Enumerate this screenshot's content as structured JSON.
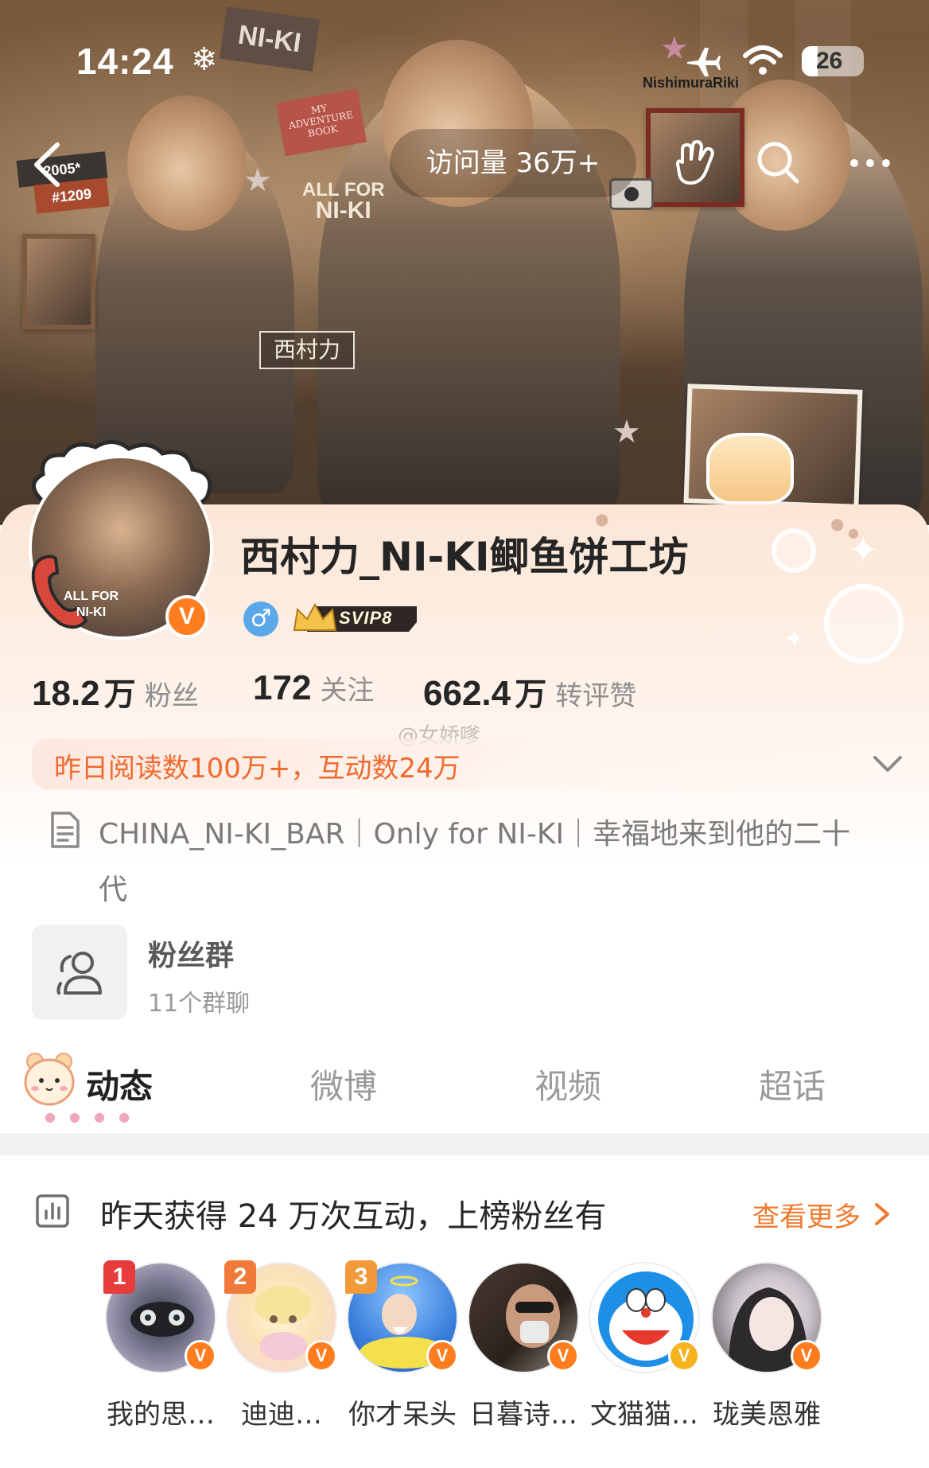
{
  "status_bar": {
    "time": "14:24",
    "time_icon": "snowflake-icon",
    "brand": "NishimuraRiki",
    "battery": "26",
    "icons": [
      "airplane-icon",
      "wifi-icon",
      "battery-icon"
    ]
  },
  "banner": {
    "tag_year": "2005*",
    "tag_date": "#1209",
    "all_for_line1": "ALL FOR",
    "all_for_line2": "NI-KI",
    "name_badge": "西村力",
    "scrap_top": "NI-KI",
    "scrap_note": "MY ADVENTURE BOOK"
  },
  "nav": {
    "visits": "访问量 36万+",
    "icons": [
      "back-icon",
      "wave-hand-icon",
      "search-icon",
      "more-icon"
    ]
  },
  "profile": {
    "username": "西村力_NI-KI鲫鱼饼工坊",
    "avatar_line1": "ALL FOR",
    "avatar_line2": "NI-KI",
    "verified": "V",
    "gender": "♂",
    "svip": "SVIP8",
    "stats": [
      {
        "num": "18.2",
        "unit": "万",
        "label": "粉丝"
      },
      {
        "num": "172",
        "unit": "",
        "label": "关注"
      },
      {
        "num": "662.4",
        "unit": "万",
        "label": "转评赞"
      }
    ],
    "watermark": "@女娇嗲",
    "reads": "昨日阅读数100万+，互动数24万",
    "bio": "CHINA_NI-KI_BAR｜Only for NI-KI｜幸福地来到他的二十代",
    "fan_group_title": "粉丝群",
    "fan_group_sub": "11个群聊"
  },
  "tabs": [
    {
      "label": "动态",
      "active": true
    },
    {
      "label": "微博",
      "active": false
    },
    {
      "label": "视频",
      "active": false
    },
    {
      "label": "超话",
      "active": false
    }
  ],
  "ranking": {
    "title": "昨天获得 24 万次互动，上榜粉丝有",
    "more": "查看更多",
    "fans": [
      {
        "name": "我的思…",
        "rank": "1",
        "badge": "V",
        "badge_color": "#ff7d1f"
      },
      {
        "name": "迪迪…",
        "rank": "2",
        "badge": "V",
        "badge_color": "#ff7d1f"
      },
      {
        "name": "你才呆头",
        "rank": "3",
        "badge": "V",
        "badge_color": "#ff7d1f"
      },
      {
        "name": "日暮诗…",
        "rank": "",
        "badge": "V",
        "badge_color": "#ff7d1f"
      },
      {
        "name": "文猫猫…",
        "rank": "",
        "badge": "V",
        "badge_color": "#f5b320"
      },
      {
        "name": "珑美恩雅",
        "rank": "",
        "badge": "V",
        "badge_color": "#ff7d1f"
      }
    ]
  },
  "colors": {
    "accent": "#f06a2e",
    "verified": "#ff7d1f",
    "rank1": "#e83b3b",
    "rank2": "#f07a3a",
    "rank3": "#f29a3a"
  }
}
